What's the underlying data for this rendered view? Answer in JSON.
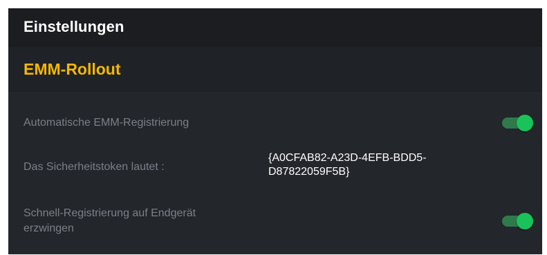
{
  "header": {
    "title": "Einstellungen"
  },
  "section": {
    "title": "EMM-Rollout"
  },
  "settings": {
    "auto_registration": {
      "label": "Automatische EMM-Registrierung",
      "enabled": true
    },
    "security_token": {
      "label": "Das Sicherheitstoken lautet :",
      "value_line1": "{A0CFAB82-A23D-4EFB-BDD5-",
      "value_line2": "D87822059F5B}"
    },
    "force_quick_registration": {
      "label_line1": "Schnell-Registrierung auf Endgerät",
      "label_line2": "erzwingen",
      "enabled": true
    }
  },
  "colors": {
    "panel_bg": "#23262b",
    "header_bg": "#1b1d21",
    "accent": "#f5b800",
    "toggle_on": "#19c25a",
    "label": "#7c8087"
  }
}
